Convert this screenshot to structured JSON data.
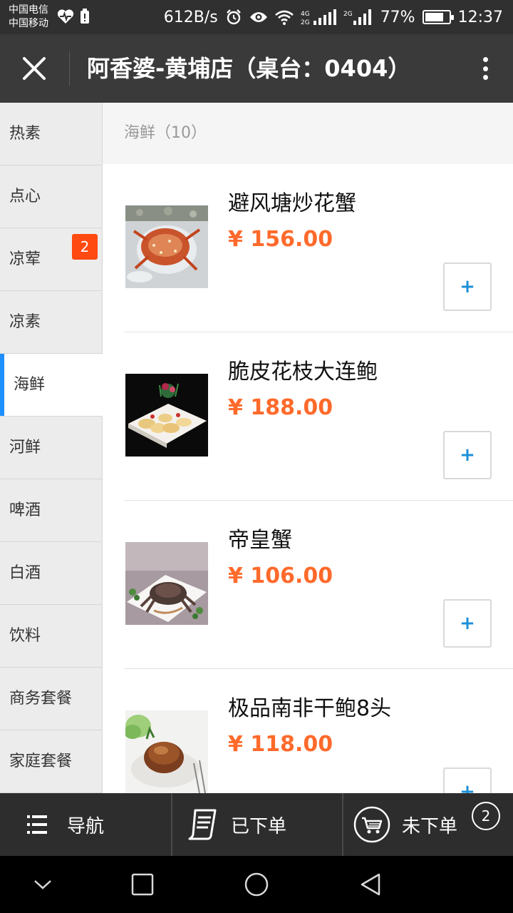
{
  "status_bar": {
    "carrier_1": "中国电信",
    "carrier_2": "中国移动",
    "net_speed": "612B/s",
    "battery_percent": "77%",
    "battery_level": 0.77,
    "time": "12:37"
  },
  "header": {
    "title": "阿香婆-黄埔店（桌台：0404）"
  },
  "sidebar": {
    "items": [
      {
        "label": "热素"
      },
      {
        "label": "点心"
      },
      {
        "label": "凉荤",
        "badge": "2"
      },
      {
        "label": "凉素"
      },
      {
        "label": "海鲜",
        "active": true
      },
      {
        "label": "河鲜"
      },
      {
        "label": "啤酒"
      },
      {
        "label": "白酒"
      },
      {
        "label": "饮料"
      },
      {
        "label": "商务套餐"
      },
      {
        "label": "家庭套餐"
      }
    ]
  },
  "main": {
    "section_title": "海鲜（10）",
    "items": [
      {
        "name": "避风塘炒花蟹",
        "price": "¥ 156.00",
        "add_label": "+"
      },
      {
        "name": "脆皮花枝大连鲍",
        "price": "¥ 188.00",
        "add_label": "+"
      },
      {
        "name": "帝皇蟹",
        "price": "¥ 106.00",
        "add_label": "+"
      },
      {
        "name": "极品南非干鲍8头",
        "price": "¥ 118.00",
        "add_label": "+"
      }
    ]
  },
  "bottom_nav": {
    "nav_label": "导航",
    "ordered_label": "已下单",
    "unordered_label": "未下单",
    "unordered_count": "2"
  },
  "colors": {
    "accent_blue": "#1e90ff",
    "price_orange": "#ff6a2b",
    "badge_red": "#ff4a12",
    "header_bg": "#3a3a3a"
  }
}
